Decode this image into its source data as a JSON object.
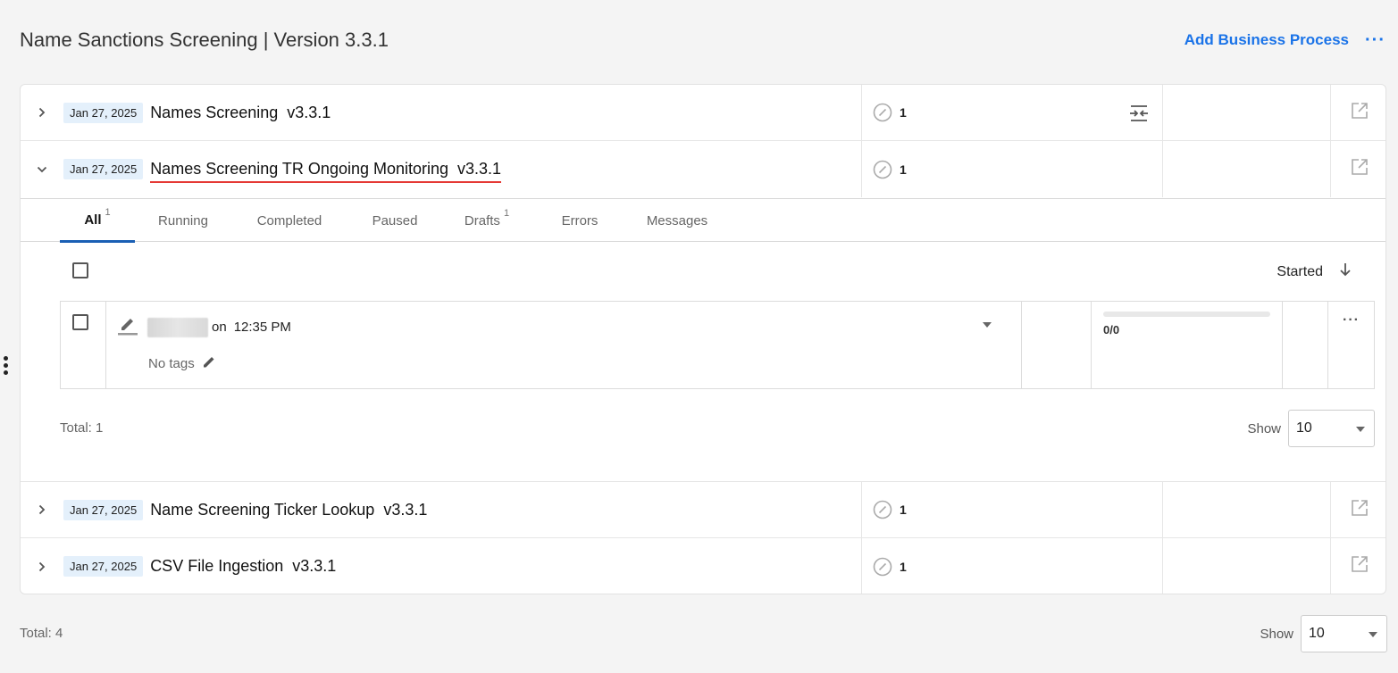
{
  "header": {
    "title": "Name Sanctions Screening | Version 3.3.1",
    "add_process_label": "Add Business Process",
    "more_label": "···"
  },
  "processes": [
    {
      "date": "Jan 27, 2025",
      "name": "Names Screening  v3.3.1",
      "count": "1",
      "expanded": false,
      "has_flow_icon": true
    },
    {
      "date": "Jan 27, 2025",
      "name": "Names Screening TR Ongoing Monitoring  v3.3.1",
      "count": "1",
      "expanded": true,
      "has_flow_icon": false
    },
    {
      "date": "Jan 27, 2025",
      "name": "Name Screening Ticker Lookup  v3.3.1",
      "count": "1",
      "expanded": false,
      "has_flow_icon": false
    },
    {
      "date": "Jan 27, 2025",
      "name": "CSV File Ingestion  v3.3.1",
      "count": "1",
      "expanded": false,
      "has_flow_icon": false
    }
  ],
  "instances_panel": {
    "tabs": [
      {
        "label": "All",
        "badge": "1",
        "active": true
      },
      {
        "label": "Running",
        "badge": ""
      },
      {
        "label": "Completed",
        "badge": ""
      },
      {
        "label": "Paused",
        "badge": ""
      },
      {
        "label": "Drafts",
        "badge": "1"
      },
      {
        "label": "Errors",
        "badge": ""
      },
      {
        "label": "Messages",
        "badge": ""
      }
    ],
    "sort_label": "Started",
    "instance": {
      "on_label": "on",
      "time": "12:35 PM",
      "tags_label": "No tags",
      "progress_text": "0/0",
      "progress_fraction": 0,
      "more_label": "···"
    },
    "total_label": "Total: 1",
    "show_label": "Show",
    "page_size": "10"
  },
  "footer": {
    "total_label": "Total: 4",
    "show_label": "Show",
    "page_size": "10"
  },
  "colors": {
    "accent": "#1a73e8",
    "underline": "#e53935",
    "date_badge_bg": "#e4f0fb"
  }
}
